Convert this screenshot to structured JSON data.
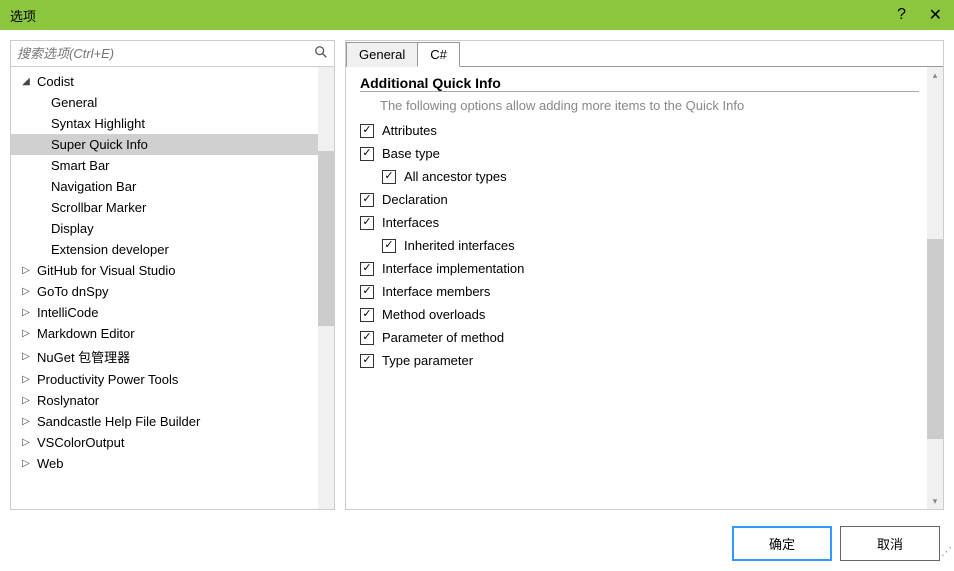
{
  "titlebar": {
    "title": "选项"
  },
  "search": {
    "placeholder": "搜索选项(Ctrl+E)"
  },
  "tree": {
    "root": {
      "label": "Codist",
      "children": [
        {
          "label": "General"
        },
        {
          "label": "Syntax Highlight"
        },
        {
          "label": "Super Quick Info",
          "selected": true
        },
        {
          "label": "Smart Bar"
        },
        {
          "label": "Navigation Bar"
        },
        {
          "label": "Scrollbar Marker"
        },
        {
          "label": "Display"
        },
        {
          "label": "Extension developer"
        }
      ]
    },
    "siblings": [
      {
        "label": "GitHub for Visual Studio"
      },
      {
        "label": "GoTo dnSpy"
      },
      {
        "label": "IntelliCode"
      },
      {
        "label": "Markdown Editor"
      },
      {
        "label": "NuGet 包管理器"
      },
      {
        "label": "Productivity Power Tools"
      },
      {
        "label": "Roslynator"
      },
      {
        "label": "Sandcastle Help File Builder"
      },
      {
        "label": "VSColorOutput"
      },
      {
        "label": "Web"
      }
    ]
  },
  "tabs": [
    {
      "label": "General",
      "active": false
    },
    {
      "label": "C#",
      "active": true
    }
  ],
  "section": {
    "title": "Additional Quick Info",
    "desc": "The following options allow adding more items to the Quick Info"
  },
  "options": [
    {
      "label": "Attributes",
      "checked": true,
      "indent": false
    },
    {
      "label": "Base type",
      "checked": true,
      "indent": false
    },
    {
      "label": "All ancestor types",
      "checked": true,
      "indent": true
    },
    {
      "label": "Declaration",
      "checked": true,
      "indent": false
    },
    {
      "label": "Interfaces",
      "checked": true,
      "indent": false
    },
    {
      "label": "Inherited interfaces",
      "checked": true,
      "indent": true
    },
    {
      "label": "Interface implementation",
      "checked": true,
      "indent": false
    },
    {
      "label": "Interface members",
      "checked": true,
      "indent": false
    },
    {
      "label": "Method overloads",
      "checked": true,
      "indent": false
    },
    {
      "label": "Parameter of method",
      "checked": true,
      "indent": false
    },
    {
      "label": "Type parameter",
      "checked": true,
      "indent": false
    }
  ],
  "buttons": {
    "ok": "确定",
    "cancel": "取消"
  }
}
